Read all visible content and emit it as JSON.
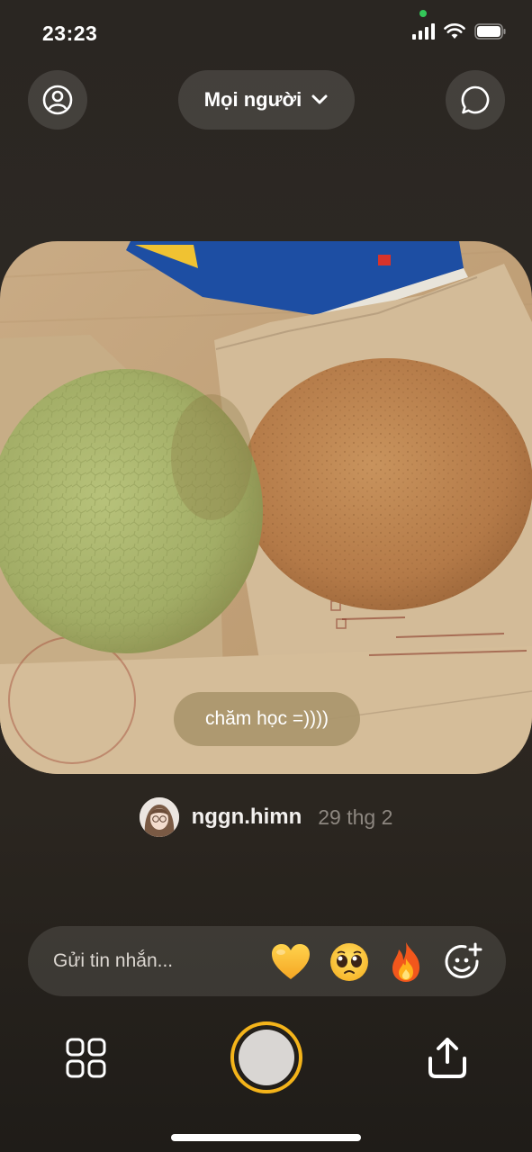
{
  "status_bar": {
    "time": "23:23"
  },
  "header": {
    "audience_label": "Mọi người",
    "profile_icon": "person-circle-icon",
    "chevron_icon": "chevron-down-icon",
    "chat_icon": "chat-bubble-icon"
  },
  "post": {
    "caption": "chăm học =))))",
    "author": {
      "username": "nggn.himn",
      "date": "29 thg 2"
    }
  },
  "message_bar": {
    "placeholder": "Gửi tin nhắn...",
    "reactions": [
      {
        "name": "yellow-heart-icon",
        "glyph": "💛"
      },
      {
        "name": "pleading-face-icon",
        "glyph": "🥺"
      },
      {
        "name": "fire-icon",
        "glyph": "🔥"
      }
    ],
    "add_reaction_icon": "add-emoji-icon"
  },
  "bottom_bar": {
    "grid_icon": "grid-icon",
    "shutter_icon": "shutter-button",
    "share_icon": "share-icon"
  },
  "colors": {
    "shutter_ring": "#f4b41a",
    "caption_bg": "#aa966c",
    "mic_indicator": "#34c759"
  }
}
